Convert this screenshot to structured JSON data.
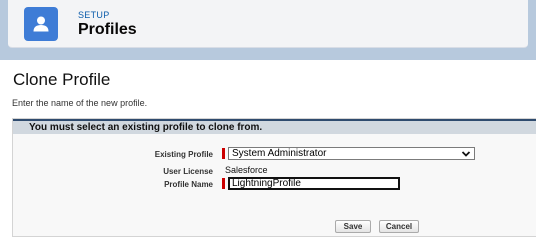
{
  "header": {
    "section_label": "SETUP",
    "title": "Profiles",
    "icon": "user-icon",
    "colors": {
      "band": "#b7c9dd",
      "icon_bg": "#3e7cd6",
      "setup_label": "#0b5cab"
    }
  },
  "page": {
    "title": "Clone Profile",
    "subtitle": "Enter the name of the new profile."
  },
  "form": {
    "error_message": "You must select an existing profile to clone from.",
    "existing_profile": {
      "label": "Existing Profile",
      "value": "System Administrator"
    },
    "user_license": {
      "label": "User License",
      "value": "Salesforce"
    },
    "profile_name": {
      "label": "Profile Name",
      "value": "LightningProfile"
    },
    "required_color": "#cc0000"
  },
  "buttons": {
    "save": "Save",
    "cancel": "Cancel"
  }
}
